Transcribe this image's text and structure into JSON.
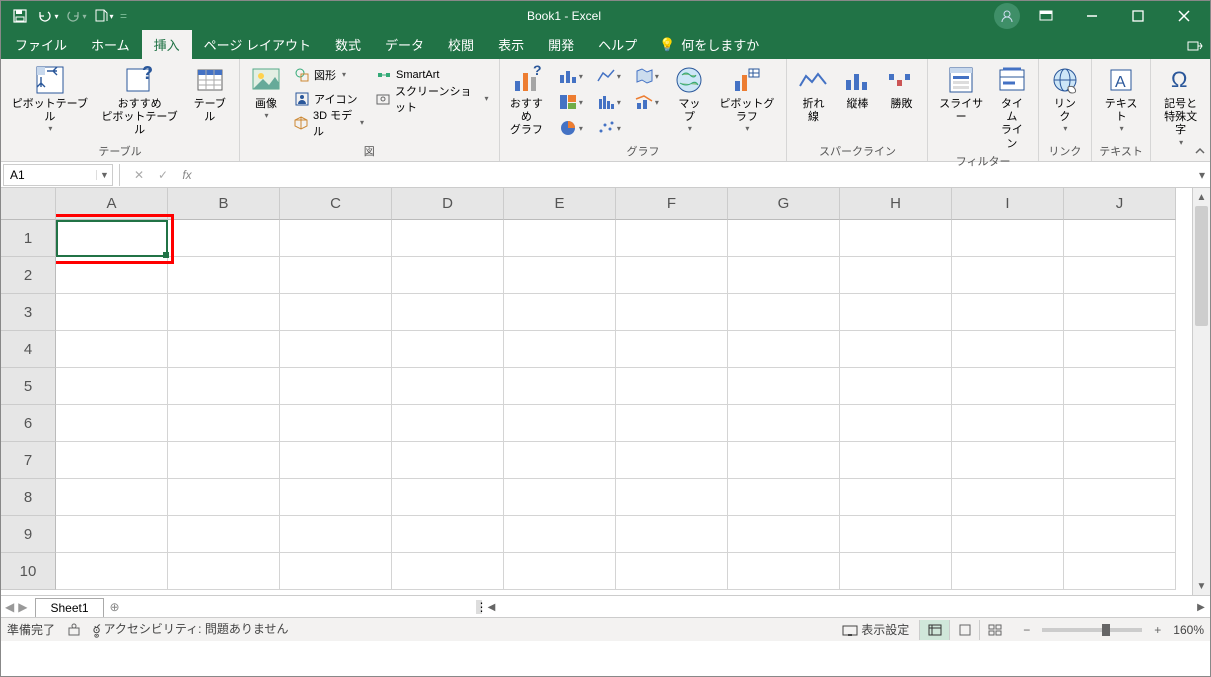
{
  "title": "Book1  -  Excel",
  "qat": {
    "save": "save",
    "undo": "undo",
    "redo": "redo",
    "print_preview": "print-preview"
  },
  "tabs": [
    "ファイル",
    "ホーム",
    "挿入",
    "ページ レイアウト",
    "数式",
    "データ",
    "校閲",
    "表示",
    "開発",
    "ヘルプ"
  ],
  "active_tab_index": 2,
  "tell_me": "何をしますか",
  "ribbon": {
    "tables_group": "テーブル",
    "pivot_table": "ピボットテーブル",
    "recommended_pivot": "おすすめ\nピボットテーブル",
    "table": "テーブル",
    "illustrations_group": "図",
    "picture": "画像",
    "shapes": "図形",
    "icons": "アイコン",
    "three_d": "3D モデル",
    "smartart": "SmartArt",
    "screenshot": "スクリーンショット",
    "charts_group": "グラフ",
    "recommended_charts": "おすすめ\nグラフ",
    "maps": "マップ",
    "pivot_chart": "ピボットグラフ",
    "sparklines_group": "スパークライン",
    "spark_line": "折れ線",
    "spark_column": "縦棒",
    "spark_winloss": "勝敗",
    "filters_group": "フィルター",
    "slicer": "スライサー",
    "timeline": "タイム\nライン",
    "links_group": "リンク",
    "link": "リン\nク",
    "text_group": "テキスト",
    "text": "テキスト",
    "symbols_group": "記号と\n特殊文字",
    "symbols": "記号と\n特殊文字"
  },
  "name_box": "A1",
  "formula_value": "",
  "columns": [
    "A",
    "B",
    "C",
    "D",
    "E",
    "F",
    "G",
    "H",
    "I",
    "J"
  ],
  "rows": [
    "1",
    "2",
    "3",
    "4",
    "5",
    "6",
    "7",
    "8",
    "9",
    "10"
  ],
  "selected_cell": "A1",
  "sheet_tabs": [
    "Sheet1"
  ],
  "status": {
    "ready": "準備完了",
    "accessibility": "アクセシビリティ: 問題ありません",
    "display_settings": "表示設定",
    "zoom": "160%"
  },
  "colors": {
    "accent": "#217346"
  }
}
